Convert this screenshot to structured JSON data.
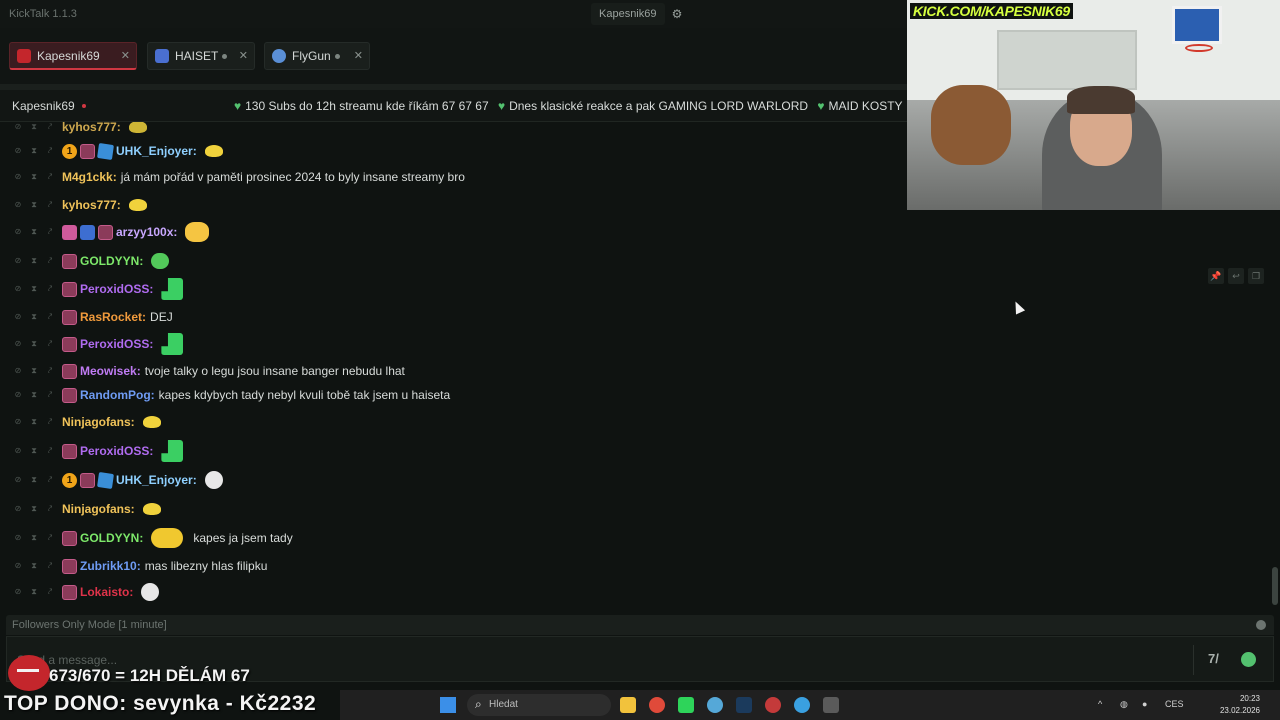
{
  "app": {
    "title": "KickTalk 1.1.3",
    "center_user": "Kapesnik69",
    "settings_icon": "gear-icon"
  },
  "tabs": [
    {
      "label": "Kapesnik69",
      "active": true,
      "color": "#c4262c"
    },
    {
      "label": "HAISET",
      "active": false,
      "color": "#4a6fd0"
    },
    {
      "label": "FlyGun",
      "active": false,
      "color": "#5a8fd6"
    }
  ],
  "channel": {
    "name": "Kapesnik69",
    "ticker": "130 Subs do 12h streamu kde říkám 67 67 67",
    "ticker2": "Dnes klasické reakce a pak GAMING LORD WARLORD",
    "ticker3": "MAID KOSTY"
  },
  "chat": {
    "messages": [
      {
        "user": "kyhos777:",
        "color": "#f0c35a",
        "text": "",
        "emote": "yellow",
        "badges": [],
        "partial": true
      },
      {
        "user": "UHK_Enjoyer:",
        "color": "#8fd0ff",
        "text": "",
        "emote": "yellow",
        "badges": [
          "gold",
          "sub",
          "cube"
        ],
        "gold_label": "1"
      },
      {
        "user": "M4g1ckk:",
        "color": "#f0c35a",
        "text": "já mám pořád v paměti prosinec 2024 to byly insane streamy bro",
        "emote": "",
        "badges": []
      },
      {
        "user": "kyhos777:",
        "color": "#f0c35a",
        "text": "",
        "emote": "yellow",
        "badges": []
      },
      {
        "user": "arzyy100x:",
        "color": "#c9a8ff",
        "text": "",
        "emote": "duck",
        "badges": [
          "pink",
          "blue",
          "sub"
        ]
      },
      {
        "user": "GOLDYYN:",
        "color": "#7de86a",
        "text": "",
        "emote": "green",
        "badges": [
          "sub"
        ]
      },
      {
        "user": "PeroxidOSS:",
        "color": "#b06cf0",
        "text": "",
        "emote": "chair",
        "badges": [
          "sub"
        ]
      },
      {
        "user": "RasRocket:",
        "color": "#f09a3c",
        "text": "DEJ",
        "emote": "",
        "badges": [
          "sub"
        ]
      },
      {
        "user": "PeroxidOSS:",
        "color": "#b06cf0",
        "text": "",
        "emote": "chair",
        "badges": [
          "sub"
        ]
      },
      {
        "user": "Meowisek:",
        "color": "#c07cf4",
        "text": "tvoje talky o legu jsou insane banger nebudu lhat",
        "emote": "",
        "badges": [
          "sub"
        ]
      },
      {
        "user": "RandomPog:",
        "color": "#6f9cf4",
        "text": "kapes kdybych tady nebyl kvuli tobě tak jsem u haiseta",
        "emote": "",
        "badges": [
          "sub"
        ]
      },
      {
        "user": "Ninjagofans:",
        "color": "#f0c35a",
        "text": "",
        "emote": "yellow",
        "badges": []
      },
      {
        "user": "PeroxidOSS:",
        "color": "#b06cf0",
        "text": "",
        "emote": "chair",
        "badges": [
          "sub"
        ]
      },
      {
        "user": "UHK_Enjoyer:",
        "color": "#8fd0ff",
        "text": "",
        "emote": "skull",
        "badges": [
          "gold",
          "sub",
          "cube"
        ],
        "gold_label": "1"
      },
      {
        "user": "Ninjagofans:",
        "color": "#f0c35a",
        "text": "",
        "emote": "yellow",
        "badges": []
      },
      {
        "user": "GOLDYYN:",
        "color": "#7de86a",
        "text": "kapes ja jsem tady",
        "emote": "smiley",
        "badges": [
          "sub"
        ]
      },
      {
        "user": "Zubrikk10:",
        "color": "#6f9cf4",
        "text": "mas libezny hlas filipku",
        "emote": "",
        "badges": [
          "sub"
        ]
      },
      {
        "user": "Lokaisto:",
        "color": "#e0334a",
        "text": "",
        "emote": "skull",
        "badges": [
          "sub"
        ]
      }
    ]
  },
  "input": {
    "mode": "Followers Only Mode [1 minute]",
    "placeholder": "Send a message...",
    "kick_label": "7/"
  },
  "overlay": {
    "cam_title": "KICK.COM/KAPESNIK69",
    "goal": "673/670 = 12H DĚLÁM 67",
    "top_dono": "TOP DONO: sevynka - Kč2232"
  },
  "taskbar": {
    "search_placeholder": "Hledat",
    "lang": "CES",
    "time": "20:23",
    "date": "23.02.2026"
  }
}
